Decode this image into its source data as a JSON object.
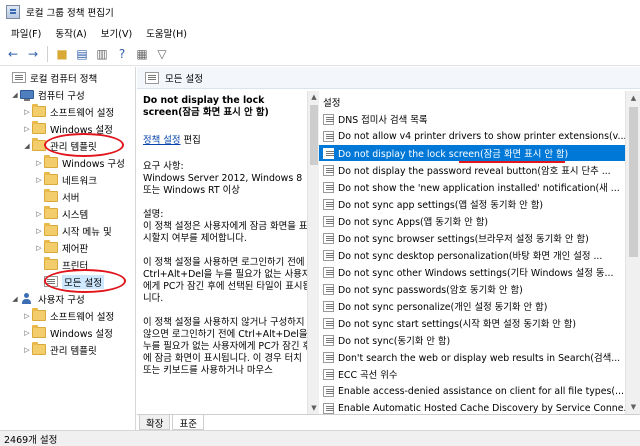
{
  "window": {
    "title": "로컬 그룹 정책 편집기"
  },
  "menu": {
    "items": [
      "파일(F)",
      "동작(A)",
      "보기(V)",
      "도움말(H)"
    ]
  },
  "toolbar": {
    "icons": [
      "back-arrow-icon",
      "forward-arrow-icon",
      "up-folder-icon",
      "show-hide-tree-icon",
      "properties-icon",
      "help-icon",
      "view-icon",
      "filter-icon"
    ]
  },
  "tree": {
    "items": [
      {
        "label": "로컬 컴퓨터 정책",
        "icon": "policy"
      },
      {
        "label": "컴퓨터 구성",
        "icon": "computer"
      },
      {
        "label": "소프트웨어 설정",
        "icon": "folder"
      },
      {
        "label": "Windows 설정",
        "icon": "folder"
      },
      {
        "label": "관리 템플릿",
        "icon": "folder"
      },
      {
        "label": "Windows 구성",
        "icon": "folder"
      },
      {
        "label": "네트워크",
        "icon": "folder"
      },
      {
        "label": "서버",
        "icon": "folder"
      },
      {
        "label": "시스템",
        "icon": "folder"
      },
      {
        "label": "시작 메뉴 및",
        "icon": "folder"
      },
      {
        "label": "제어판",
        "icon": "folder"
      },
      {
        "label": "프린터",
        "icon": "folder"
      },
      {
        "label": "모든 설정",
        "icon": "policy"
      },
      {
        "label": "사용자 구성",
        "icon": "user"
      },
      {
        "label": "소프트웨어 설정",
        "icon": "folder"
      },
      {
        "label": "Windows 설정",
        "icon": "folder"
      },
      {
        "label": "관리 템플릿",
        "icon": "folder"
      }
    ]
  },
  "detail": {
    "header": "모든 설정",
    "description": {
      "title": "Do not display the lock screen(잠금 화면 표시 안 함)",
      "edit_link": "정책 설정",
      "edit_suffix": " 편집",
      "requirements": "요구 사항:\nWindows Server 2012, Windows 8 또는 Windows RT 이상",
      "desc_label": "설명:",
      "p1": "이 정책 설정은 사용자에게 잠금 화면을 표시할지 여부를 제어합니다.",
      "p2": "이 정책 설정을 사용하면 로그인하기 전에 Ctrl+Alt+Del을 누를 필요가 없는 사용자에게 PC가 잠긴 후에 선택된 타일이 표시됩니다.",
      "p3": "이 정책 설정을 사용하지 않거나 구성하지 않으면 로그인하기 전에 Ctrl+Alt+Del을 누를 필요가 없는 사용자에게 PC가 잠긴 후에 잠금 화면이 표시됩니다. 이 경우 터치 또는 키보드를 사용하거나 마우스"
    },
    "list": {
      "column_header": "설정",
      "rows": [
        "DNS 접미사 검색 목록",
        "Do not allow v4 printer drivers to show printer extensions(v...",
        "Do not display the lock screen(잠금 화면 표시 안 함)",
        "Do not display the password reveal button(암호 표시 단추 ...",
        "Do not show the 'new application installed' notification(새 ...",
        "Do not sync app settings(앱 설정 동기화 안 함)",
        "Do not sync Apps(앱 동기화 안 함)",
        "Do not sync browser settings(브라우저 설정 동기화 안 함)",
        "Do not sync desktop personalization(바탕 화면 개인 설정 ...",
        "Do not sync other Windows settings(기타 Windows 설정 동...",
        "Do not sync passwords(암호 동기화 안 함)",
        "Do not sync personalize(개인 설정 동기화 안 함)",
        "Do not sync start settings(시작 화면 설정 동기화 안 함)",
        "Do not sync(동기화 안 함)",
        "Don't search the web or display web results in Search(검색...",
        "ECC 곡선 위수",
        "Enable access-denied assistance on client for all file types(...",
        "Enable Automatic Hosted Cache Discovery by Service Conne..."
      ],
      "selected_index": 2
    }
  },
  "tabs": [
    "확장",
    "표준"
  ],
  "status": {
    "text": "2469개 설정"
  },
  "colors": {
    "selection": "#0078d7",
    "annotation": "#e0161c",
    "tree_selection": "#cde8ff"
  }
}
